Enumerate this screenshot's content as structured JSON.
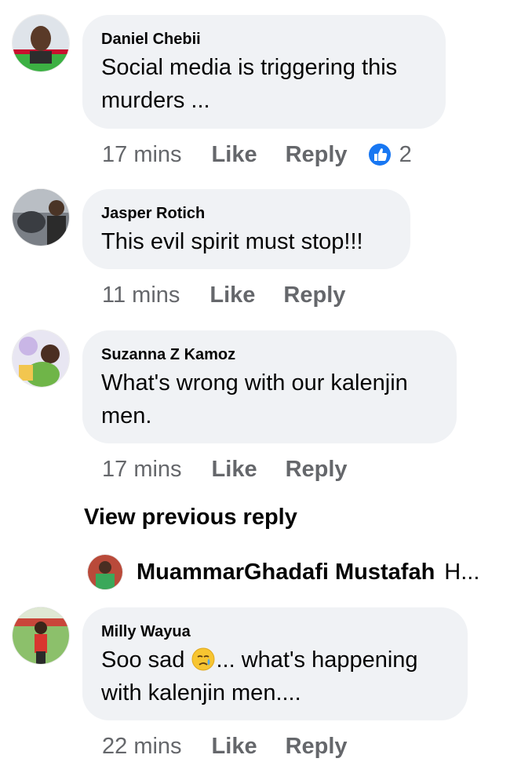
{
  "comments": [
    {
      "author": "Daniel Chebii",
      "text": "Social media is triggering this murders ...",
      "time": "17 mins",
      "like": "Like",
      "reply": "Reply",
      "reaction_count": "2"
    },
    {
      "author": "Jasper Rotich",
      "text": "This evil spirit must stop!!!",
      "time": "11 mins",
      "like": "Like",
      "reply": "Reply"
    },
    {
      "author": "Suzanna Z Kamoz",
      "text": "What's wrong with our kalenjin men.",
      "time": "17 mins",
      "like": "Like",
      "reply": "Reply"
    },
    {
      "author": "Milly Wayua",
      "text_before": "Soo sad",
      "text_after": "... what's happening with kalenjin men....",
      "time": "22 mins",
      "like": "Like",
      "reply": "Reply"
    }
  ],
  "view_previous": "View previous reply",
  "reply_preview": {
    "author": "MuammarGhadafi Mustafah",
    "text": "H..."
  },
  "colors": {
    "bubble": "#f0f2f5",
    "meta_text": "#65676b",
    "like_blue": "#1877f2"
  },
  "icons": [
    "like-reaction-icon",
    "crying-face-emoji-icon"
  ]
}
